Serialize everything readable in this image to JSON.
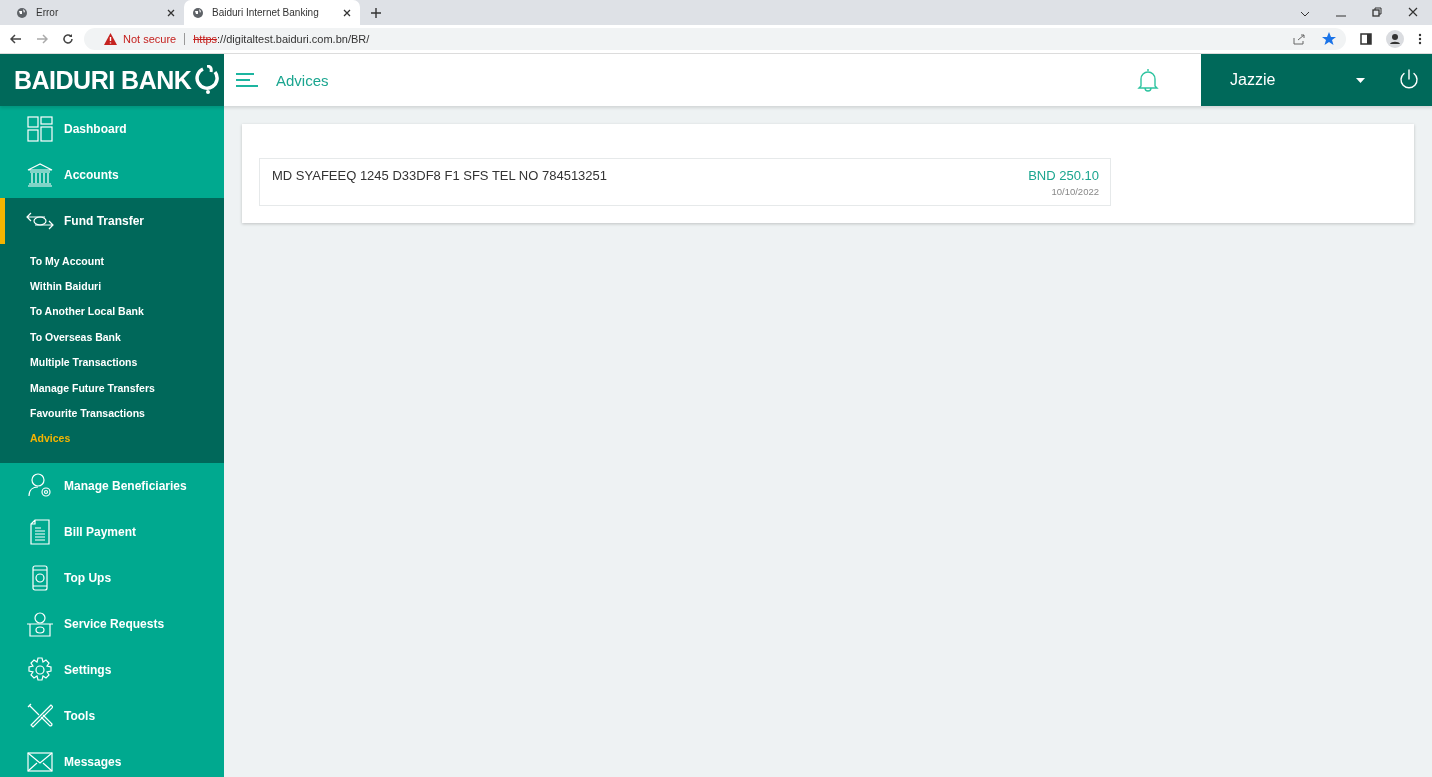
{
  "browser": {
    "tabs": [
      {
        "title": "Error",
        "selected": false
      },
      {
        "title": "Baiduri Internet Banking",
        "selected": true
      }
    ],
    "security": "Not secure",
    "url_scheme": "https",
    "url_rest": "://digitaltest.baiduri.com.bn/BR/"
  },
  "header": {
    "logo": "BAIDURI BANK",
    "title": "Advices",
    "user": "Jazzie"
  },
  "sidebar": {
    "items": [
      {
        "label": "Dashboard",
        "selected": false,
        "expanded": false
      },
      {
        "label": "Accounts",
        "selected": false,
        "expanded": false
      },
      {
        "label": "Fund Transfer",
        "selected": true,
        "expanded": true,
        "children": [
          {
            "label": "To My Account",
            "selected": false
          },
          {
            "label": "Within Baiduri",
            "selected": false
          },
          {
            "label": "To Another Local Bank",
            "selected": false
          },
          {
            "label": "To Overseas Bank",
            "selected": false
          },
          {
            "label": "Multiple Transactions",
            "selected": false
          },
          {
            "label": "Manage Future Transfers",
            "selected": false
          },
          {
            "label": "Favourite Transactions",
            "selected": false
          },
          {
            "label": "Advices",
            "selected": true
          }
        ]
      },
      {
        "label": "Manage Beneficiaries",
        "selected": false,
        "expanded": false
      },
      {
        "label": "Bill Payment",
        "selected": false,
        "expanded": false
      },
      {
        "label": "Top Ups",
        "selected": false,
        "expanded": false
      },
      {
        "label": "Service Requests",
        "selected": false,
        "expanded": false
      },
      {
        "label": "Settings",
        "selected": false,
        "expanded": false
      },
      {
        "label": "Tools",
        "selected": false,
        "expanded": false
      },
      {
        "label": "Messages",
        "selected": false,
        "expanded": false
      }
    ]
  },
  "advices": [
    {
      "description": "MD SYAFEEQ 1245 D33DF8 F1 SFS TEL NO 784513251",
      "amount": "BND 250.10",
      "date": "10/10/2022"
    }
  ]
}
